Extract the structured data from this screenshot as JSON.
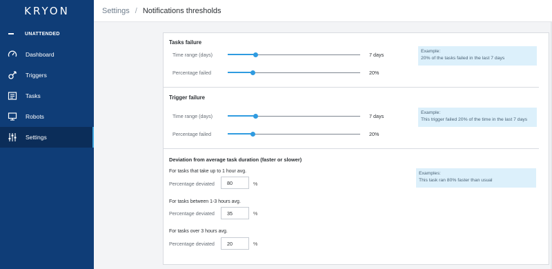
{
  "sidebar": {
    "logo": "KRYON",
    "mode_label": "UNATTENDED",
    "items": [
      {
        "label": "Dashboard",
        "icon": "gauge-icon"
      },
      {
        "label": "Triggers",
        "icon": "trigger-icon"
      },
      {
        "label": "Tasks",
        "icon": "tasks-icon"
      },
      {
        "label": "Robots",
        "icon": "monitor-icon"
      },
      {
        "label": "Settings",
        "icon": "sliders-icon",
        "active": true
      }
    ]
  },
  "header": {
    "breadcrumb_root": "Settings",
    "separator": "/",
    "page_title": "Notifications thresholds"
  },
  "tasks_failure": {
    "title": "Tasks failure",
    "time_range_label": "Time range (days)",
    "time_range_value": "7 days",
    "time_range_position": 0.21,
    "percentage_label": "Percentage failed",
    "percentage_value": "20%",
    "percentage_position": 0.19,
    "example_title": "Example:",
    "example_text": "20% of the tasks failed in the last 7 days"
  },
  "trigger_failure": {
    "title": "Trigger failure",
    "time_range_label": "Time range (days)",
    "time_range_value": "7 days",
    "time_range_position": 0.21,
    "percentage_label": "Percentage failed",
    "percentage_value": "20%",
    "percentage_position": 0.19,
    "example_title": "Example:",
    "example_text": "This trigger failed 20% of the time in the last 7 days"
  },
  "deviation": {
    "title": "Deviation from average task duration (faster or slower)",
    "example_title": "Examples:",
    "example_text": "This task ran 80% faster than usual",
    "groups": [
      {
        "heading": "For tasks that take up to 1 hour avg.",
        "label": "Percentage deviated",
        "value": "80",
        "unit": "%"
      },
      {
        "heading": "For tasks between 1-3 hours avg.",
        "label": "Percentage deviated",
        "value": "35",
        "unit": "%"
      },
      {
        "heading": "For tasks over 3 hours avg.",
        "label": "Percentage deviated",
        "value": "20",
        "unit": "%"
      }
    ]
  },
  "colors": {
    "sidebar": "#0f3d77",
    "sidebar_active": "#0b2d59",
    "accent": "#2f9be0",
    "example_bg": "#dcf0fb"
  }
}
